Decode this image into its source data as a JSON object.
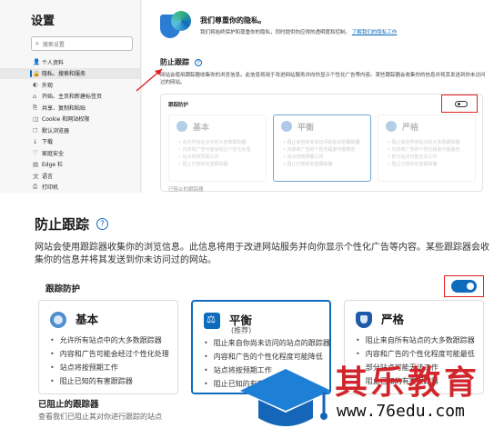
{
  "top": {
    "sidebar": {
      "title": "设置",
      "search_placeholder": "搜索设置",
      "items": [
        {
          "icon": "person-icon",
          "glyph": "👤",
          "label": "个人资料"
        },
        {
          "icon": "lock-icon",
          "glyph": "🔒",
          "label": "隐私、搜索和服务",
          "active": true
        },
        {
          "icon": "appearance-icon",
          "glyph": "◐",
          "label": "外观"
        },
        {
          "icon": "home-icon",
          "glyph": "⌂",
          "label": "开始、主页和新建标签页"
        },
        {
          "icon": "share-icon",
          "glyph": "⎘",
          "label": "共享、复制和粘贴"
        },
        {
          "icon": "cookie-icon",
          "glyph": "◫",
          "label": "Cookie 和网站权限"
        },
        {
          "icon": "browser-icon",
          "glyph": "◻",
          "label": "默认浏览器"
        },
        {
          "icon": "download-icon",
          "glyph": "↓",
          "label": "下载"
        },
        {
          "icon": "family-icon",
          "glyph": "♡",
          "label": "家庭安全"
        },
        {
          "icon": "edge-bar-icon",
          "glyph": "▤",
          "label": "Edge 栏"
        },
        {
          "icon": "language-icon",
          "glyph": "文",
          "label": "语言"
        },
        {
          "icon": "printer-icon",
          "glyph": "⎙",
          "label": "打印机"
        }
      ]
    },
    "privacy": {
      "heading": "我们尊重你的隐私。",
      "text": "我们将始终保护和尊重你的隐私，同时提供你应得的透明度和控制。",
      "link": "了解我们的隐私工作"
    },
    "tracking_title": "防止跟踪",
    "tracking_desc": "网站会使用跟踪器收集你的浏览信息。此信息将用于改进网站服务并向你显示个性化广告等内容。某些跟踪器会收集你的信息并将其发送到你未访问过的网站。",
    "box_label": "跟踪防护",
    "cards": [
      {
        "title": "基本",
        "items": [
          "允许所有站点中的大多数跟踪器",
          "内容和广告可能会经过个性化处理",
          "站点将按预期工作",
          "阻止已知的有害跟踪器"
        ]
      },
      {
        "title": "平衡",
        "items": [
          "阻止来自你尚未访问的站点的跟踪器",
          "内容和广告的个性化程度可能降低",
          "站点将按预期工作",
          "阻止已知的有害跟踪器"
        ]
      },
      {
        "title": "严格",
        "items": [
          "阻止来自所有站点的大多数跟踪器",
          "内容和广告的个性化程度可能最低",
          "部分站点可能无法工作",
          "阻止已知的有害跟踪器"
        ]
      }
    ],
    "blocked_label": "已阻止的跟踪器"
  },
  "zoom": {
    "title": "防止跟踪",
    "desc": "网站会使用跟踪器收集你的浏览信息。此信息将用于改进网站服务并向你显示个性化广告等内容。某些跟踪器会收集你的信息并将其发送到你未访问过的网站。",
    "box_label": "跟踪防护",
    "toggle_on": true,
    "cards": [
      {
        "title": "基本",
        "subtitle": "",
        "items": [
          "允许所有站点中的大多数跟踪器",
          "内容和广告可能会经过个性化处理",
          "站点将按预期工作",
          "阻止已知的有害跟踪器"
        ]
      },
      {
        "title": "平衡",
        "subtitle": "(推荐)",
        "items": [
          "阻止来自你尚未访问的站点的跟踪器",
          "内容和广告的个性化程度可能降低",
          "站点将按预期工作",
          "阻止已知的有害跟踪器"
        ]
      },
      {
        "title": "严格",
        "subtitle": "",
        "items": [
          "阻止来自所有站点的大多数跟踪器",
          "内容和广告的个性化程度可能最低",
          "部分站点可能无法工作",
          "阻止已知的有害跟踪器"
        ]
      }
    ],
    "blocked_label": "已阻止的跟踪器",
    "blocked_sub": "查看我们已阻止其对你进行跟踪的站点"
  },
  "watermark": {
    "name": "其乐教育",
    "url": "www.76edu.com"
  },
  "colors": {
    "accent": "#0f6cbd",
    "highlight": "#e02020",
    "watermark_red": "#d0262c"
  }
}
